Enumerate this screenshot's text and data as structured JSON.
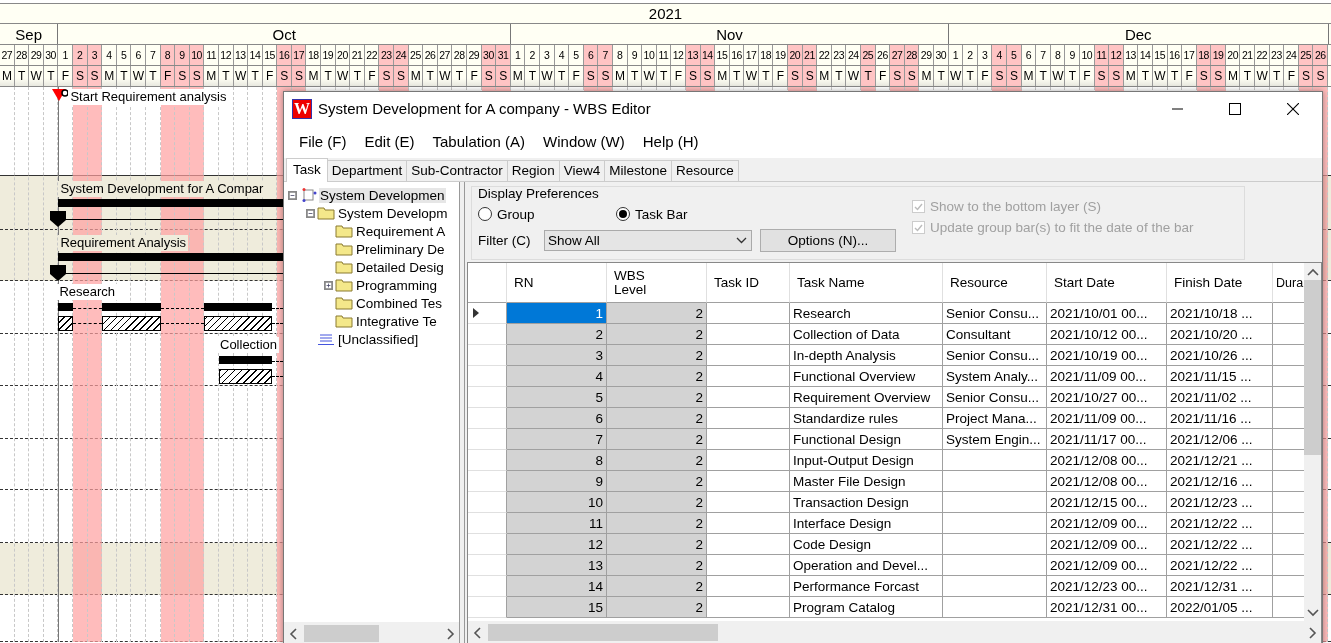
{
  "gantt": {
    "year": "2021",
    "months": [
      {
        "name": "Sep",
        "days": [
          {
            "d": "27",
            "w": "M",
            "holiday": false
          },
          {
            "d": "28",
            "w": "T",
            "holiday": false
          },
          {
            "d": "29",
            "w": "W",
            "holiday": false
          },
          {
            "d": "30",
            "w": "T",
            "holiday": false
          }
        ]
      },
      {
        "name": "Oct",
        "days": [
          {
            "d": "1",
            "w": "F",
            "holiday": false
          },
          {
            "d": "2",
            "w": "S",
            "holiday": true
          },
          {
            "d": "3",
            "w": "S",
            "holiday": true
          },
          {
            "d": "4",
            "w": "M",
            "holiday": false
          },
          {
            "d": "5",
            "w": "T",
            "holiday": false
          },
          {
            "d": "6",
            "w": "W",
            "holiday": false
          },
          {
            "d": "7",
            "w": "T",
            "holiday": false
          },
          {
            "d": "8",
            "w": "F",
            "holiday": true
          },
          {
            "d": "9",
            "w": "S",
            "holiday": true
          },
          {
            "d": "10",
            "w": "S",
            "holiday": true
          },
          {
            "d": "11",
            "w": "M",
            "holiday": false
          },
          {
            "d": "12",
            "w": "T",
            "holiday": false
          },
          {
            "d": "13",
            "w": "W",
            "holiday": false
          },
          {
            "d": "14",
            "w": "T",
            "holiday": false
          },
          {
            "d": "15",
            "w": "F",
            "holiday": false
          },
          {
            "d": "16",
            "w": "S",
            "holiday": true
          },
          {
            "d": "17",
            "w": "S",
            "holiday": true
          },
          {
            "d": "18",
            "w": "M",
            "holiday": false
          },
          {
            "d": "19",
            "w": "T",
            "holiday": false
          },
          {
            "d": "20",
            "w": "W",
            "holiday": false
          },
          {
            "d": "21",
            "w": "T",
            "holiday": false
          },
          {
            "d": "22",
            "w": "F",
            "holiday": false
          },
          {
            "d": "23",
            "w": "S",
            "holiday": true
          },
          {
            "d": "24",
            "w": "S",
            "holiday": true
          },
          {
            "d": "25",
            "w": "M",
            "holiday": false
          },
          {
            "d": "26",
            "w": "T",
            "holiday": false
          },
          {
            "d": "27",
            "w": "W",
            "holiday": false
          },
          {
            "d": "28",
            "w": "T",
            "holiday": false
          },
          {
            "d": "29",
            "w": "F",
            "holiday": false
          },
          {
            "d": "30",
            "w": "S",
            "holiday": true
          },
          {
            "d": "31",
            "w": "S",
            "holiday": true
          }
        ]
      },
      {
        "name": "Nov",
        "days": [
          {
            "d": "1",
            "w": "M",
            "holiday": false
          },
          {
            "d": "2",
            "w": "T",
            "holiday": false
          },
          {
            "d": "3",
            "w": "W",
            "holiday": false
          },
          {
            "d": "4",
            "w": "T",
            "holiday": false
          },
          {
            "d": "5",
            "w": "F",
            "holiday": false
          },
          {
            "d": "6",
            "w": "S",
            "holiday": true
          },
          {
            "d": "7",
            "w": "S",
            "holiday": true
          },
          {
            "d": "8",
            "w": "M",
            "holiday": false
          },
          {
            "d": "9",
            "w": "T",
            "holiday": false
          },
          {
            "d": "10",
            "w": "W",
            "holiday": false
          },
          {
            "d": "11",
            "w": "T",
            "holiday": false
          },
          {
            "d": "12",
            "w": "F",
            "holiday": false
          },
          {
            "d": "13",
            "w": "S",
            "holiday": true
          },
          {
            "d": "14",
            "w": "S",
            "holiday": true
          },
          {
            "d": "15",
            "w": "M",
            "holiday": false
          },
          {
            "d": "16",
            "w": "T",
            "holiday": false
          },
          {
            "d": "17",
            "w": "W",
            "holiday": false
          },
          {
            "d": "18",
            "w": "T",
            "holiday": false
          },
          {
            "d": "19",
            "w": "F",
            "holiday": false
          },
          {
            "d": "20",
            "w": "S",
            "holiday": true
          },
          {
            "d": "21",
            "w": "S",
            "holiday": true
          },
          {
            "d": "22",
            "w": "M",
            "holiday": false
          },
          {
            "d": "23",
            "w": "T",
            "holiday": false
          },
          {
            "d": "24",
            "w": "W",
            "holiday": false
          },
          {
            "d": "25",
            "w": "T",
            "holiday": true
          },
          {
            "d": "26",
            "w": "F",
            "holiday": false
          },
          {
            "d": "27",
            "w": "S",
            "holiday": true
          },
          {
            "d": "28",
            "w": "S",
            "holiday": true
          },
          {
            "d": "29",
            "w": "M",
            "holiday": false
          },
          {
            "d": "30",
            "w": "T",
            "holiday": false
          }
        ]
      },
      {
        "name": "Dec",
        "days": [
          {
            "d": "1",
            "w": "W",
            "holiday": false
          },
          {
            "d": "2",
            "w": "T",
            "holiday": false
          },
          {
            "d": "3",
            "w": "F",
            "holiday": false
          },
          {
            "d": "4",
            "w": "S",
            "holiday": true
          },
          {
            "d": "5",
            "w": "S",
            "holiday": true
          },
          {
            "d": "6",
            "w": "M",
            "holiday": false
          },
          {
            "d": "7",
            "w": "T",
            "holiday": false
          },
          {
            "d": "8",
            "w": "W",
            "holiday": false
          },
          {
            "d": "9",
            "w": "T",
            "holiday": false
          },
          {
            "d": "10",
            "w": "F",
            "holiday": false
          },
          {
            "d": "11",
            "w": "S",
            "holiday": true
          },
          {
            "d": "12",
            "w": "S",
            "holiday": true
          },
          {
            "d": "13",
            "w": "M",
            "holiday": false
          },
          {
            "d": "14",
            "w": "T",
            "holiday": false
          },
          {
            "d": "15",
            "w": "W",
            "holiday": false
          },
          {
            "d": "16",
            "w": "T",
            "holiday": false
          },
          {
            "d": "17",
            "w": "F",
            "holiday": false
          },
          {
            "d": "18",
            "w": "S",
            "holiday": true
          },
          {
            "d": "19",
            "w": "S",
            "holiday": true
          },
          {
            "d": "20",
            "w": "M",
            "holiday": false
          },
          {
            "d": "21",
            "w": "T",
            "holiday": false
          },
          {
            "d": "22",
            "w": "W",
            "holiday": false
          },
          {
            "d": "23",
            "w": "T",
            "holiday": false
          },
          {
            "d": "24",
            "w": "F",
            "holiday": false
          },
          {
            "d": "25",
            "w": "S",
            "holiday": true
          },
          {
            "d": "26",
            "w": "S",
            "holiday": true
          }
        ]
      }
    ],
    "rows": [
      {
        "kind": "milestone",
        "label": "Start Requirement analysis"
      },
      {
        "kind": "group",
        "label": "System Development for A Compar"
      },
      {
        "kind": "group",
        "label": "Requirement Analysis"
      },
      {
        "kind": "task",
        "label": "Research"
      },
      {
        "kind": "task",
        "label": "Collection"
      },
      {
        "kind": "blank"
      },
      {
        "kind": "blank"
      },
      {
        "kind": "blank"
      },
      {
        "kind": "band"
      },
      {
        "kind": "blank"
      }
    ]
  },
  "window": {
    "icon_letter": "W",
    "title": "System Development for A company - WBS Editor"
  },
  "menu": [
    "File (F)",
    "Edit (E)",
    "Tabulation (A)",
    "Window (W)",
    "Help (H)"
  ],
  "tabs": [
    {
      "label": "Task",
      "selected": true
    },
    {
      "label": "Department",
      "selected": false
    },
    {
      "label": "Sub-Contractor",
      "selected": false
    },
    {
      "label": "Region",
      "selected": false
    },
    {
      "label": "View4",
      "selected": false
    },
    {
      "label": "Milestone",
      "selected": false
    },
    {
      "label": "Resource",
      "selected": false
    }
  ],
  "tree": [
    {
      "label": "System Developmen",
      "kind": "project",
      "expanded": true,
      "selected": true,
      "children": [
        {
          "label": "System Developm",
          "kind": "folder",
          "expanded": true,
          "selected": false,
          "children": [
            {
              "label": "Requirement A",
              "kind": "folder",
              "selected": false
            },
            {
              "label": "Preliminary De",
              "kind": "folder",
              "selected": false
            },
            {
              "label": "Detailed Desig",
              "kind": "folder",
              "selected": false
            },
            {
              "label": "Programming",
              "kind": "folder",
              "expanded": false,
              "selected": false
            },
            {
              "label": "Combined Tes",
              "kind": "folder",
              "selected": false
            },
            {
              "label": "Integrative Te",
              "kind": "folder",
              "selected": false
            }
          ]
        },
        {
          "label": "[Unclassified]",
          "kind": "list",
          "selected": false
        }
      ]
    }
  ],
  "display_preferences": {
    "title": "Display Preferences",
    "options": [
      {
        "label": "Group",
        "selected": false
      },
      {
        "label": "Task Bar",
        "selected": true
      }
    ],
    "filter": {
      "label": "Filter (C)",
      "value": "Show All"
    },
    "options_button": "Options (N)...",
    "checkboxes": [
      {
        "label": "Show to the bottom layer (S)",
        "checked": true,
        "disabled": true
      },
      {
        "label": "Update group bar(s) to fit the date of the bar",
        "checked": true,
        "disabled": true
      }
    ]
  },
  "table": {
    "columns": [
      "RN",
      "WBS\nLevel",
      "Task ID",
      "Task Name",
      "Resource",
      "Start Date",
      "Finish Date",
      "Dura"
    ],
    "rows": [
      {
        "rn": "1",
        "wbs_level": "2",
        "task_name": "Research",
        "resource": "Senior Consu...",
        "start_date": "2021/10/01 00...",
        "finish_date": "2021/10/18 ...",
        "selected": true
      },
      {
        "rn": "2",
        "wbs_level": "2",
        "task_name": "Collection of Data",
        "resource": "Consultant",
        "start_date": "2021/10/12 00...",
        "finish_date": "2021/10/20 ...",
        "selected": false
      },
      {
        "rn": "3",
        "wbs_level": "2",
        "task_name": "In-depth Analysis",
        "resource": "Senior Consu...",
        "start_date": "2021/10/19 00...",
        "finish_date": "2021/10/26 ...",
        "selected": false
      },
      {
        "rn": "4",
        "wbs_level": "2",
        "task_name": "Functional Overview",
        "resource": "System Analy...",
        "start_date": "2021/11/09 00...",
        "finish_date": "2021/11/15 ...",
        "selected": false
      },
      {
        "rn": "5",
        "wbs_level": "2",
        "task_name": "Requirement Overview",
        "resource": "Senior Consu...",
        "start_date": "2021/10/27 00...",
        "finish_date": "2021/11/02 ...",
        "selected": false
      },
      {
        "rn": "6",
        "wbs_level": "2",
        "task_name": "Standardize rules",
        "resource": "Project Mana...",
        "start_date": "2021/11/09 00...",
        "finish_date": "2021/11/16 ...",
        "selected": false
      },
      {
        "rn": "7",
        "wbs_level": "2",
        "task_name": "Functional Design",
        "resource": "System Engin...",
        "start_date": "2021/11/17 00...",
        "finish_date": "2021/12/06 ...",
        "selected": false
      },
      {
        "rn": "8",
        "wbs_level": "2",
        "task_name": "Input-Output Design",
        "start_date": "2021/12/08 00...",
        "finish_date": "2021/12/21 ...",
        "selected": false
      },
      {
        "rn": "9",
        "wbs_level": "2",
        "task_name": "Master File Design",
        "start_date": "2021/12/08 00...",
        "finish_date": "2021/12/16 ...",
        "selected": false
      },
      {
        "rn": "10",
        "wbs_level": "2",
        "task_name": "Transaction Design",
        "start_date": "2021/12/15 00...",
        "finish_date": "2021/12/23 ...",
        "selected": false
      },
      {
        "rn": "11",
        "wbs_level": "2",
        "task_name": "Interface Design",
        "start_date": "2021/12/09 00...",
        "finish_date": "2021/12/22 ...",
        "selected": false
      },
      {
        "rn": "12",
        "wbs_level": "2",
        "task_name": "Code Design",
        "start_date": "2021/12/09 00...",
        "finish_date": "2021/12/22 ...",
        "selected": false
      },
      {
        "rn": "13",
        "wbs_level": "2",
        "task_name": "Operation and Devel...",
        "start_date": "2021/12/09 00...",
        "finish_date": "2021/12/22 ...",
        "selected": false
      },
      {
        "rn": "14",
        "wbs_level": "2",
        "task_name": "Performance Forcast",
        "start_date": "2021/12/23 00...",
        "finish_date": "2021/12/31 ...",
        "selected": false
      },
      {
        "rn": "15",
        "wbs_level": "2",
        "task_name": "Program Catalog",
        "start_date": "2021/12/31 00...",
        "finish_date": "2022/01/05 ...",
        "selected": false
      }
    ]
  }
}
